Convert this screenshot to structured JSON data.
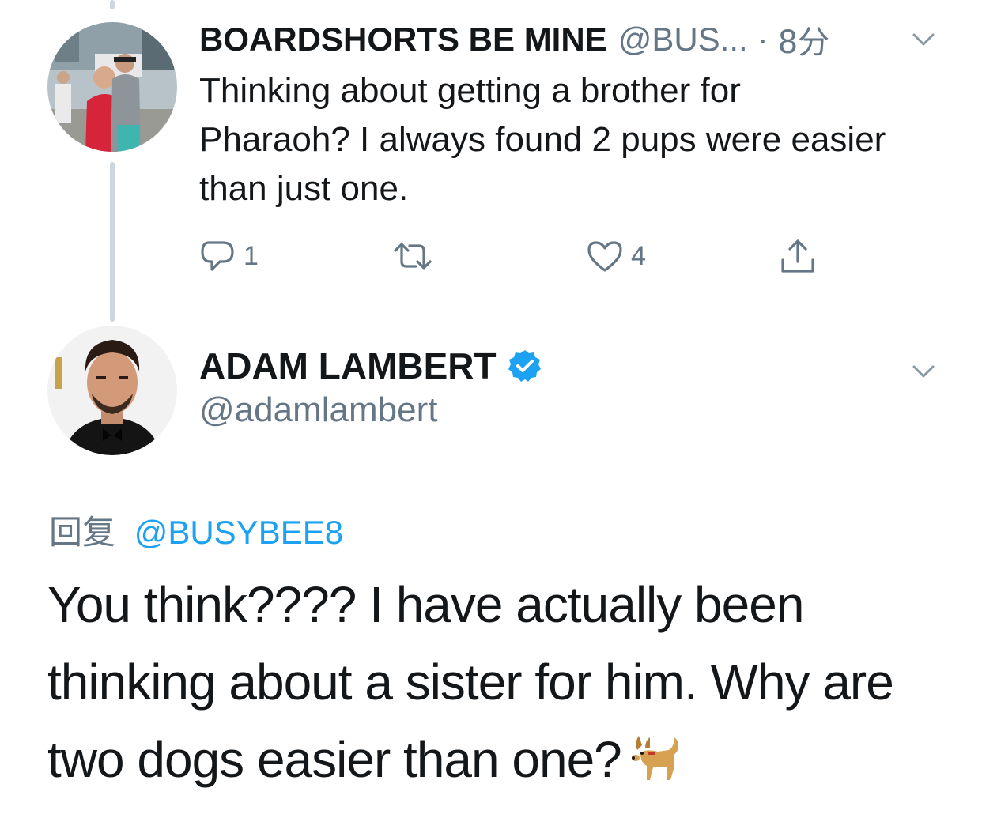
{
  "tweet1": {
    "display_name": "BOARDSHORTS BE MINE",
    "handle": "@BUS...",
    "separator": "·",
    "time": "8分",
    "text": "Thinking about getting a brother for Pharaoh?  I always found 2 pups were easier than just one.",
    "actions": {
      "reply_count": "1",
      "retweet_count": "",
      "like_count": "4"
    }
  },
  "tweet2": {
    "display_name": "ADAM LAMBERT",
    "handle": "@adamlambert",
    "verified": true,
    "reply_label": "回复",
    "reply_mention": "@BUSYBEE8",
    "text": "You think???? I have actually been thinking about a sister for him. Why are two dogs easier than one?",
    "emoji": "dog-emoji"
  },
  "colors": {
    "link": "#1da1f2",
    "secondary_text": "#657786",
    "primary_text": "#14171a",
    "thread_line": "#ccd6dd",
    "verified_badge": "#1da1f2"
  }
}
